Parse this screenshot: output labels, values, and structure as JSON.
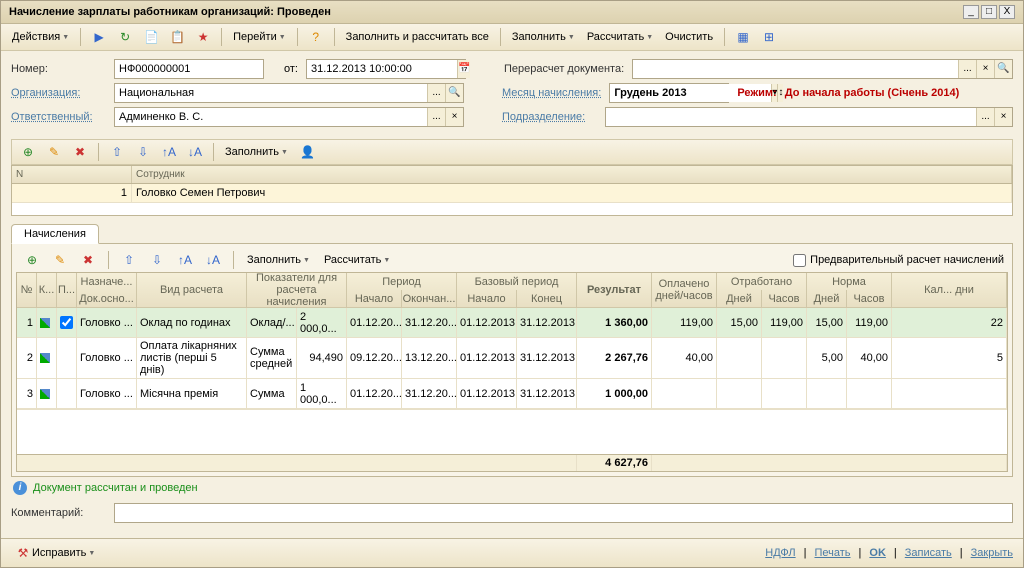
{
  "title": "Начисление зарплаты работникам организаций: Проведен",
  "toolbar": {
    "actions": "Действия",
    "goto": "Перейти",
    "fill_calc_all": "Заполнить и рассчитать все",
    "fill": "Заполнить",
    "calc": "Рассчитать",
    "clear": "Очистить"
  },
  "form": {
    "number_label": "Номер:",
    "number": "НФ000000001",
    "from_label": "от:",
    "from": "31.12.2013 10:00:00",
    "recalc_label": "Перерасчет документа:",
    "recalc": "",
    "org_label": "Организация:",
    "org": "Национальная",
    "month_label": "Месяц начисления:",
    "month": "Грудень 2013",
    "mode_label": "Режим:",
    "mode": "До начала работы (Січень 2014)",
    "resp_label": "Ответственный:",
    "resp": "Админенко В. С.",
    "dept_label": "Подразделение:",
    "dept": ""
  },
  "emp_toolbar": {
    "fill": "Заполнить"
  },
  "emp_grid": {
    "col_n": "N",
    "col_emp": "Сотрудник",
    "rows": [
      {
        "n": "1",
        "name": "Головко Семен Петрович"
      }
    ]
  },
  "tabs": {
    "accruals": "Начисления"
  },
  "accr_toolbar": {
    "fill": "Заполнить",
    "calc": "Рассчитать",
    "prelim": "Предварительный расчет начислений"
  },
  "accr_header": {
    "rownum": "№",
    "k": "К...",
    "p": "П...",
    "assign": "Назначе...",
    "docosn": "Док.осно...",
    "calc_type": "Вид расчета",
    "indicators": "Показатели для расчета начисления",
    "period": "Период",
    "start": "Начало",
    "end": "Окончан...",
    "base_period": "Базовый период",
    "bstart": "Начало",
    "bend": "Конец",
    "result": "Результат",
    "paid": "Оплачено дней/часов",
    "worked": "Отработано",
    "days": "Дней",
    "hours": "Часов",
    "norm": "Норма",
    "cal": "Кал... дни"
  },
  "accr_rows": [
    {
      "n": "1",
      "chk": true,
      "assign": "Головко ...",
      "type": "Оклад по годинах",
      "ind1": "Оклад/...",
      "ind2": "2 000,0...",
      "pstart": "01.12.20...",
      "pend": "31.12.20...",
      "bstart": "01.12.2013",
      "bend": "31.12.2013",
      "result": "1 360,00",
      "paid": "119,00",
      "wdays": "15,00",
      "whours": "119,00",
      "ndays": "15,00",
      "nhours": "119,00",
      "cal": "22"
    },
    {
      "n": "2",
      "chk": false,
      "assign": "Головко ...",
      "type": "Оплата лікарняних листів (перші 5 днів)",
      "ind1": "Сумма средней",
      "ind2": "94,490",
      "pstart": "09.12.20...",
      "pend": "13.12.20...",
      "bstart": "01.12.2013",
      "bend": "31.12.2013",
      "result": "2 267,76",
      "paid": "40,00",
      "wdays": "",
      "whours": "",
      "ndays": "5,00",
      "nhours": "40,00",
      "cal": "5"
    },
    {
      "n": "3",
      "chk": false,
      "assign": "Головко ...",
      "type": "Місячна премія",
      "ind1": "Сумма",
      "ind2": "1 000,0...",
      "pstart": "01.12.20...",
      "pend": "31.12.20...",
      "bstart": "01.12.2013",
      "bend": "31.12.2013",
      "result": "1 000,00",
      "paid": "",
      "wdays": "",
      "whours": "",
      "ndays": "",
      "nhours": "",
      "cal": ""
    }
  ],
  "accr_total": "4 627,76",
  "status": "Документ рассчитан и проведен",
  "comment_label": "Комментарий:",
  "comment": "",
  "bottom": {
    "fix": "Исправить",
    "ndfl": "НДФЛ",
    "print": "Печать",
    "ok": "OK",
    "save": "Записать",
    "close": "Закрыть"
  }
}
